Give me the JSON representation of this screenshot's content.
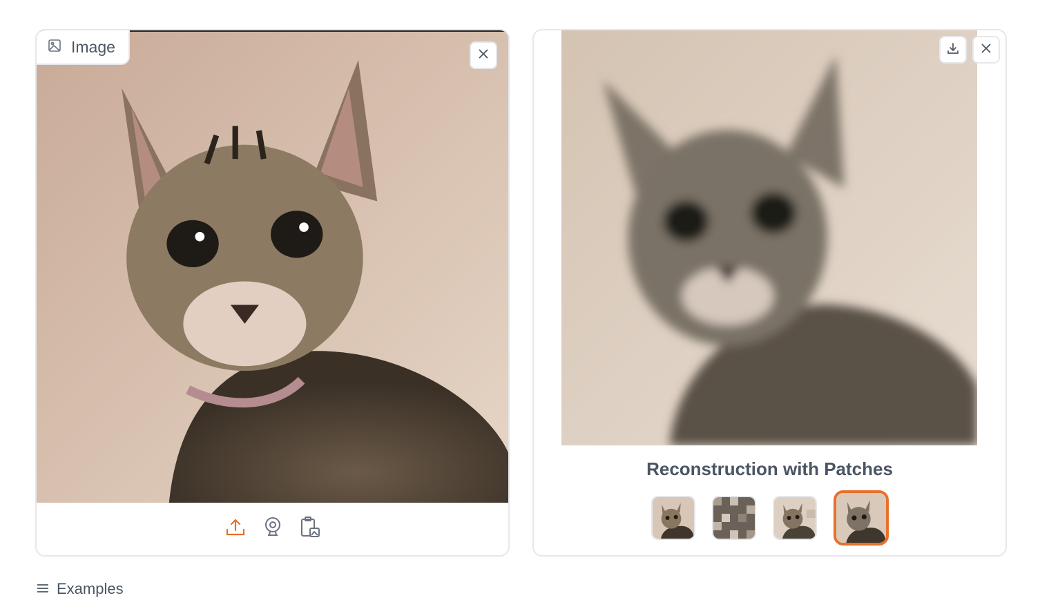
{
  "input": {
    "label": "Image",
    "icon": "image-icon",
    "close_icon": "close-icon",
    "toolbar": [
      {
        "name": "upload-icon",
        "color": "#e8702a"
      },
      {
        "name": "webcam-icon",
        "color": "#6b7280"
      },
      {
        "name": "clipboard-icon",
        "color": "#6b7280"
      }
    ]
  },
  "output": {
    "caption": "Reconstruction with Patches",
    "download_icon": "download-icon",
    "close_icon": "close-icon",
    "thumbnails": [
      {
        "name": "thumbnail-original",
        "selected": false
      },
      {
        "name": "thumbnail-masked-patches",
        "selected": false
      },
      {
        "name": "thumbnail-partial",
        "selected": false
      },
      {
        "name": "thumbnail-reconstruction",
        "selected": true
      }
    ]
  },
  "examples": {
    "label": "Examples"
  },
  "colors": {
    "accent": "#e8702a",
    "border": "#e5e7eb",
    "background_wall": "#dcc8b8"
  }
}
